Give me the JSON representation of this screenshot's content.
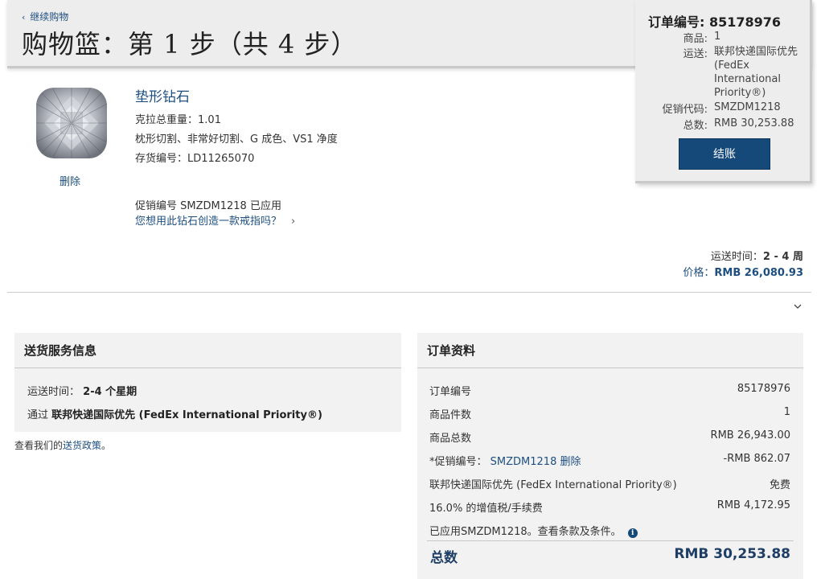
{
  "header": {
    "back_link": "继续购物",
    "title": "购物篮：第 1 步（共 4 步）"
  },
  "summary": {
    "order_label": "订单编号:",
    "order_number": "85178976",
    "items_label": "商品:",
    "items_value": "1",
    "shipping_label": "运送:",
    "shipping_value": "联邦快递国际优先 (FedEx International Priority®)",
    "promo_label": "促销代码:",
    "promo_value": "SMZDM1218",
    "total_label": "总数:",
    "total_value": "RMB 30,253.88",
    "checkout_button": "结账"
  },
  "product": {
    "delete_link": "删除",
    "name": "垫形钻石",
    "carat_label": "克拉总重量：",
    "carat_value": "1.01",
    "description": "枕形切割、非常好切割、G 成色、VS1 净度",
    "sku_label": "存货编号：",
    "sku_value": "LD11265070",
    "promo_applied": "促销编号 SMZDM1218 已应用",
    "ring_question": "您想用此钻石创造一款戒指吗？",
    "ship_time_label": "运送时间：",
    "ship_time_value": "2 - 4 周",
    "price_label": "价格：",
    "price_value": "RMB 26,080.93"
  },
  "delivery_panel": {
    "title": "送货服务信息",
    "ship_time_label": "运送时间：",
    "ship_time_value": "2-4 个星期",
    "via_label": "通过",
    "via_value": "联邦快递国际优先 (FedEx International Priority®)",
    "policy_text": "查看我们的",
    "policy_link": "送货政策",
    "policy_end": "。"
  },
  "order_panel": {
    "title": "订单资料",
    "rows": [
      {
        "label": "订单编号",
        "value": "85178976"
      },
      {
        "label": "商品件数",
        "value": "1"
      },
      {
        "label": "商品总数",
        "value": "RMB 26,943.00"
      },
      {
        "label": "*促销编号：",
        "value": "-RMB 862.07"
      },
      {
        "label": "联邦快递国际优先 (FedEx International Priority®)",
        "value": "免费"
      },
      {
        "label": "16.0% 的增值税/手续费",
        "value": "RMB 4,172.95"
      }
    ],
    "promo_code": "SMZDM1218",
    "promo_delete": "删除",
    "terms_text": "已应用SMZDM1218。查看条款及条件。",
    "total_label": "总数",
    "total_value": "RMB 30,253.88"
  },
  "colors": {
    "accent": "#1e4f80",
    "button": "#15497a",
    "panel_bg": "#f2f2f2",
    "header_bg": "#ededed"
  }
}
